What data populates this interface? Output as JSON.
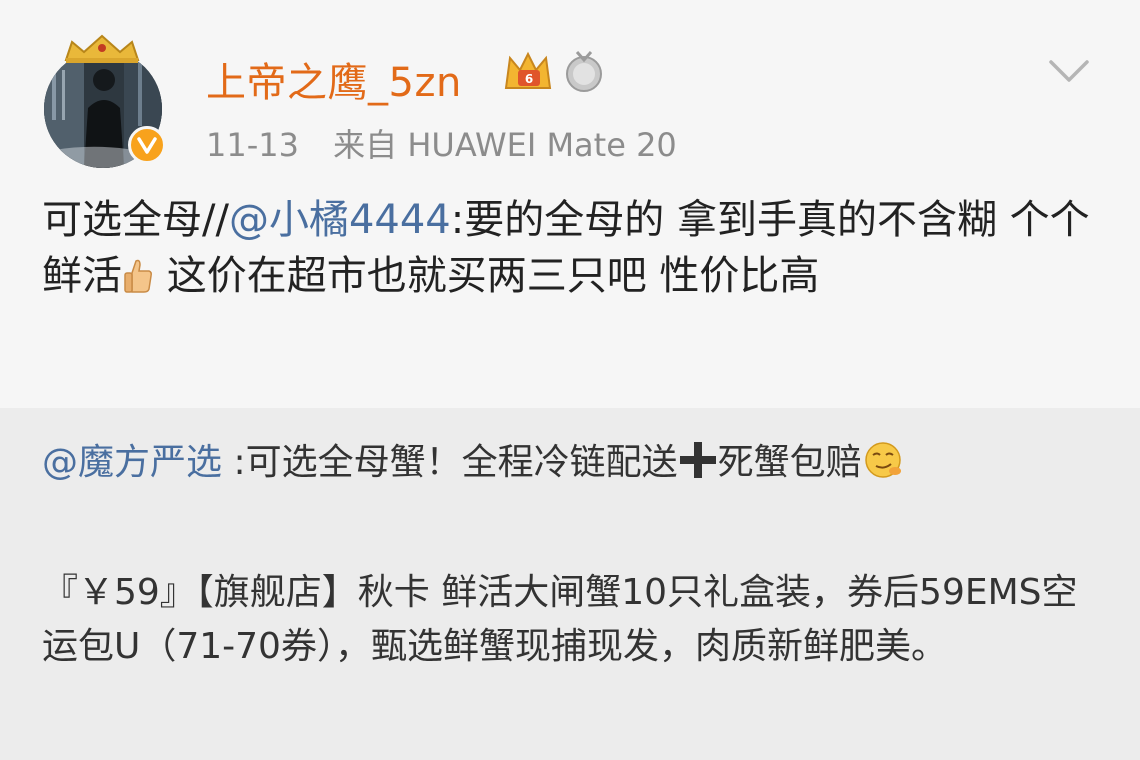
{
  "post": {
    "username": "上帝之鹰_5zn",
    "date": "11-13",
    "source_prefix": "来自",
    "source_device": "HUAWEI Mate 20",
    "text_before_mention": "可选全母//",
    "mention": "@小橘4444",
    "text_part1": ":要的全母的 拿到手真的不含糊 个个鲜活",
    "text_part2": " 这价在超市也就买两三只吧 性价比高",
    "icons": {
      "avatar": "avatar-photo",
      "crown": "crown-icon",
      "verified": "verified-v-icon",
      "vip": "vip-crown-icon",
      "medal": "medal-icon",
      "expand": "chevron-down-icon",
      "thumb": "thumbs-up-emoji"
    }
  },
  "repost": {
    "mention": "@魔方严选",
    "text_part1": " :可选全母蟹！全程冷链配送",
    "text_part2": "死蟹包赔",
    "detail": "『￥59』【旗舰店】秋卡 鲜活大闸蟹10只礼盒装，券后59EMS空运包U（71-70券），甄选鲜蟹现捕现发，肉质新鲜肥美。",
    "icons": {
      "plus": "plus-icon",
      "emoji": "smirk-emoji"
    }
  },
  "colors": {
    "username": "#e26a18",
    "mention": "#4a6fa0",
    "meta": "#8c8c8c",
    "badge": "#f8a21c"
  }
}
